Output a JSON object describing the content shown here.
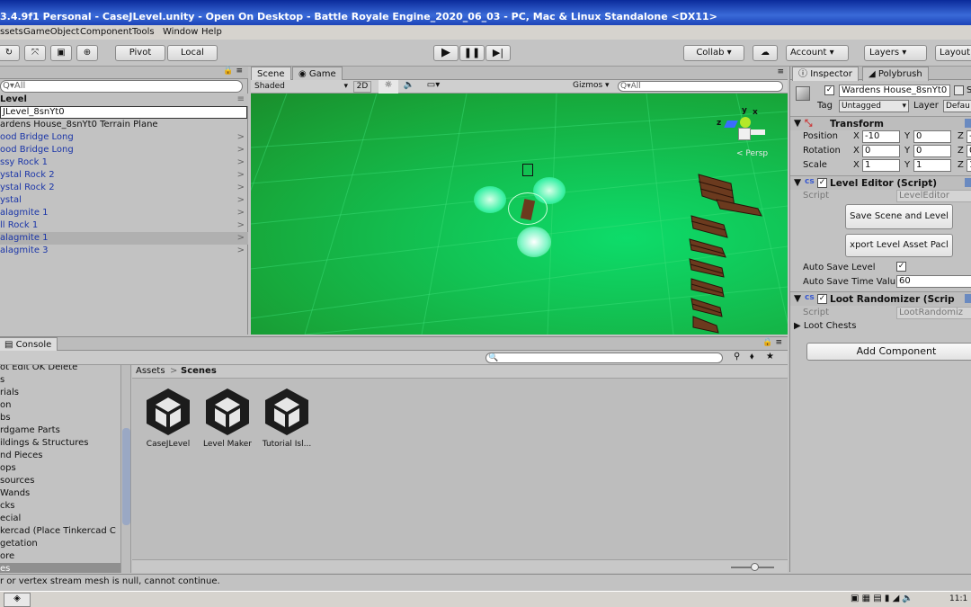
{
  "window": {
    "title": "3.4.9f1 Personal - CaseJLevel.unity - Open On Desktop - Battle Royale Engine_2020_06_03 - PC, Mac & Linux Standalone <DX11>"
  },
  "menu": [
    "ssets",
    "GameObject",
    "Component",
    "Tools",
    "Window",
    "Help"
  ],
  "toolbar": {
    "pivot": "Pivot",
    "local": "Local",
    "collab": "Collab ▾",
    "account": "Account",
    "layers": "Layers",
    "layout": "Layout"
  },
  "hierarchy": {
    "search_placeholder": "Q▾All",
    "scene_name": "Level",
    "rename_value": "JLevel_8snYt0",
    "items": [
      "ardens House_8snYt0 Terrain Plane",
      "ood Bridge Long",
      "ood Bridge Long",
      "ssy Rock 1",
      "ystal Rock 2",
      "ystal Rock 2",
      "ystal",
      "alagmite 1",
      "ll Rock 1",
      "alagmite 1",
      "alagmite 3"
    ]
  },
  "scene": {
    "tab_scene": "Scene",
    "tab_game": "Game",
    "shading": "Shaded",
    "mode_2d": "2D",
    "gizmos": "Gizmos",
    "search": "Q▾All",
    "persp": "< Persp",
    "axis_y": "y",
    "axis_x": "x",
    "axis_z": "z"
  },
  "inspector": {
    "tab_inspector": "Inspector",
    "tab_polybrush": "Polybrush",
    "object_name": "Wardens House_8snYt0",
    "static_label": "S",
    "tag_label": "Tag",
    "tag_value": "Untagged",
    "layer_label": "Layer",
    "layer_value": "Defau",
    "transform": {
      "title": "Transform",
      "rows": [
        {
          "label": "Position",
          "x": "-10",
          "y": "0",
          "z": "-"
        },
        {
          "label": "Rotation",
          "x": "0",
          "y": "0",
          "z": "0"
        },
        {
          "label": "Scale",
          "x": "1",
          "y": "1",
          "z": "1"
        }
      ]
    },
    "level_editor": {
      "title": "Level Editor (Script)",
      "script_label": "Script",
      "script_value": "LevelEditor",
      "btn_save": "Save Scene and Level",
      "btn_export": "xport Level Asset Pacl",
      "auto_save": "Auto Save Level",
      "auto_save_time_label": "Auto Save Time Valu",
      "auto_save_time": "60"
    },
    "loot": {
      "title": "Loot Randomizer (Scrip",
      "script_label": "Script",
      "script_value": "LootRandomiz",
      "chests": "Loot Chests"
    },
    "add_component": "Add Component"
  },
  "project": {
    "console_tab": "Console",
    "folders": [
      "ot Edit OK Delete",
      "s",
      "rials",
      "on",
      "bs",
      "rdgame Parts",
      "ildings & Structures",
      "nd Pieces",
      "ops",
      "sources",
      "Wands",
      "cks",
      "ecial",
      "kercad (Place Tinkercad C",
      "getation",
      "ore",
      "es"
    ],
    "breadcrumb_root": "Assets",
    "breadcrumb_current": "Scenes",
    "assets": [
      "CaseJLevel",
      "Level Maker",
      "Tutorial Isl..."
    ]
  },
  "status_message": "r or vertex stream mesh is null, cannot continue.",
  "taskbar": {
    "clock": "11:1"
  }
}
